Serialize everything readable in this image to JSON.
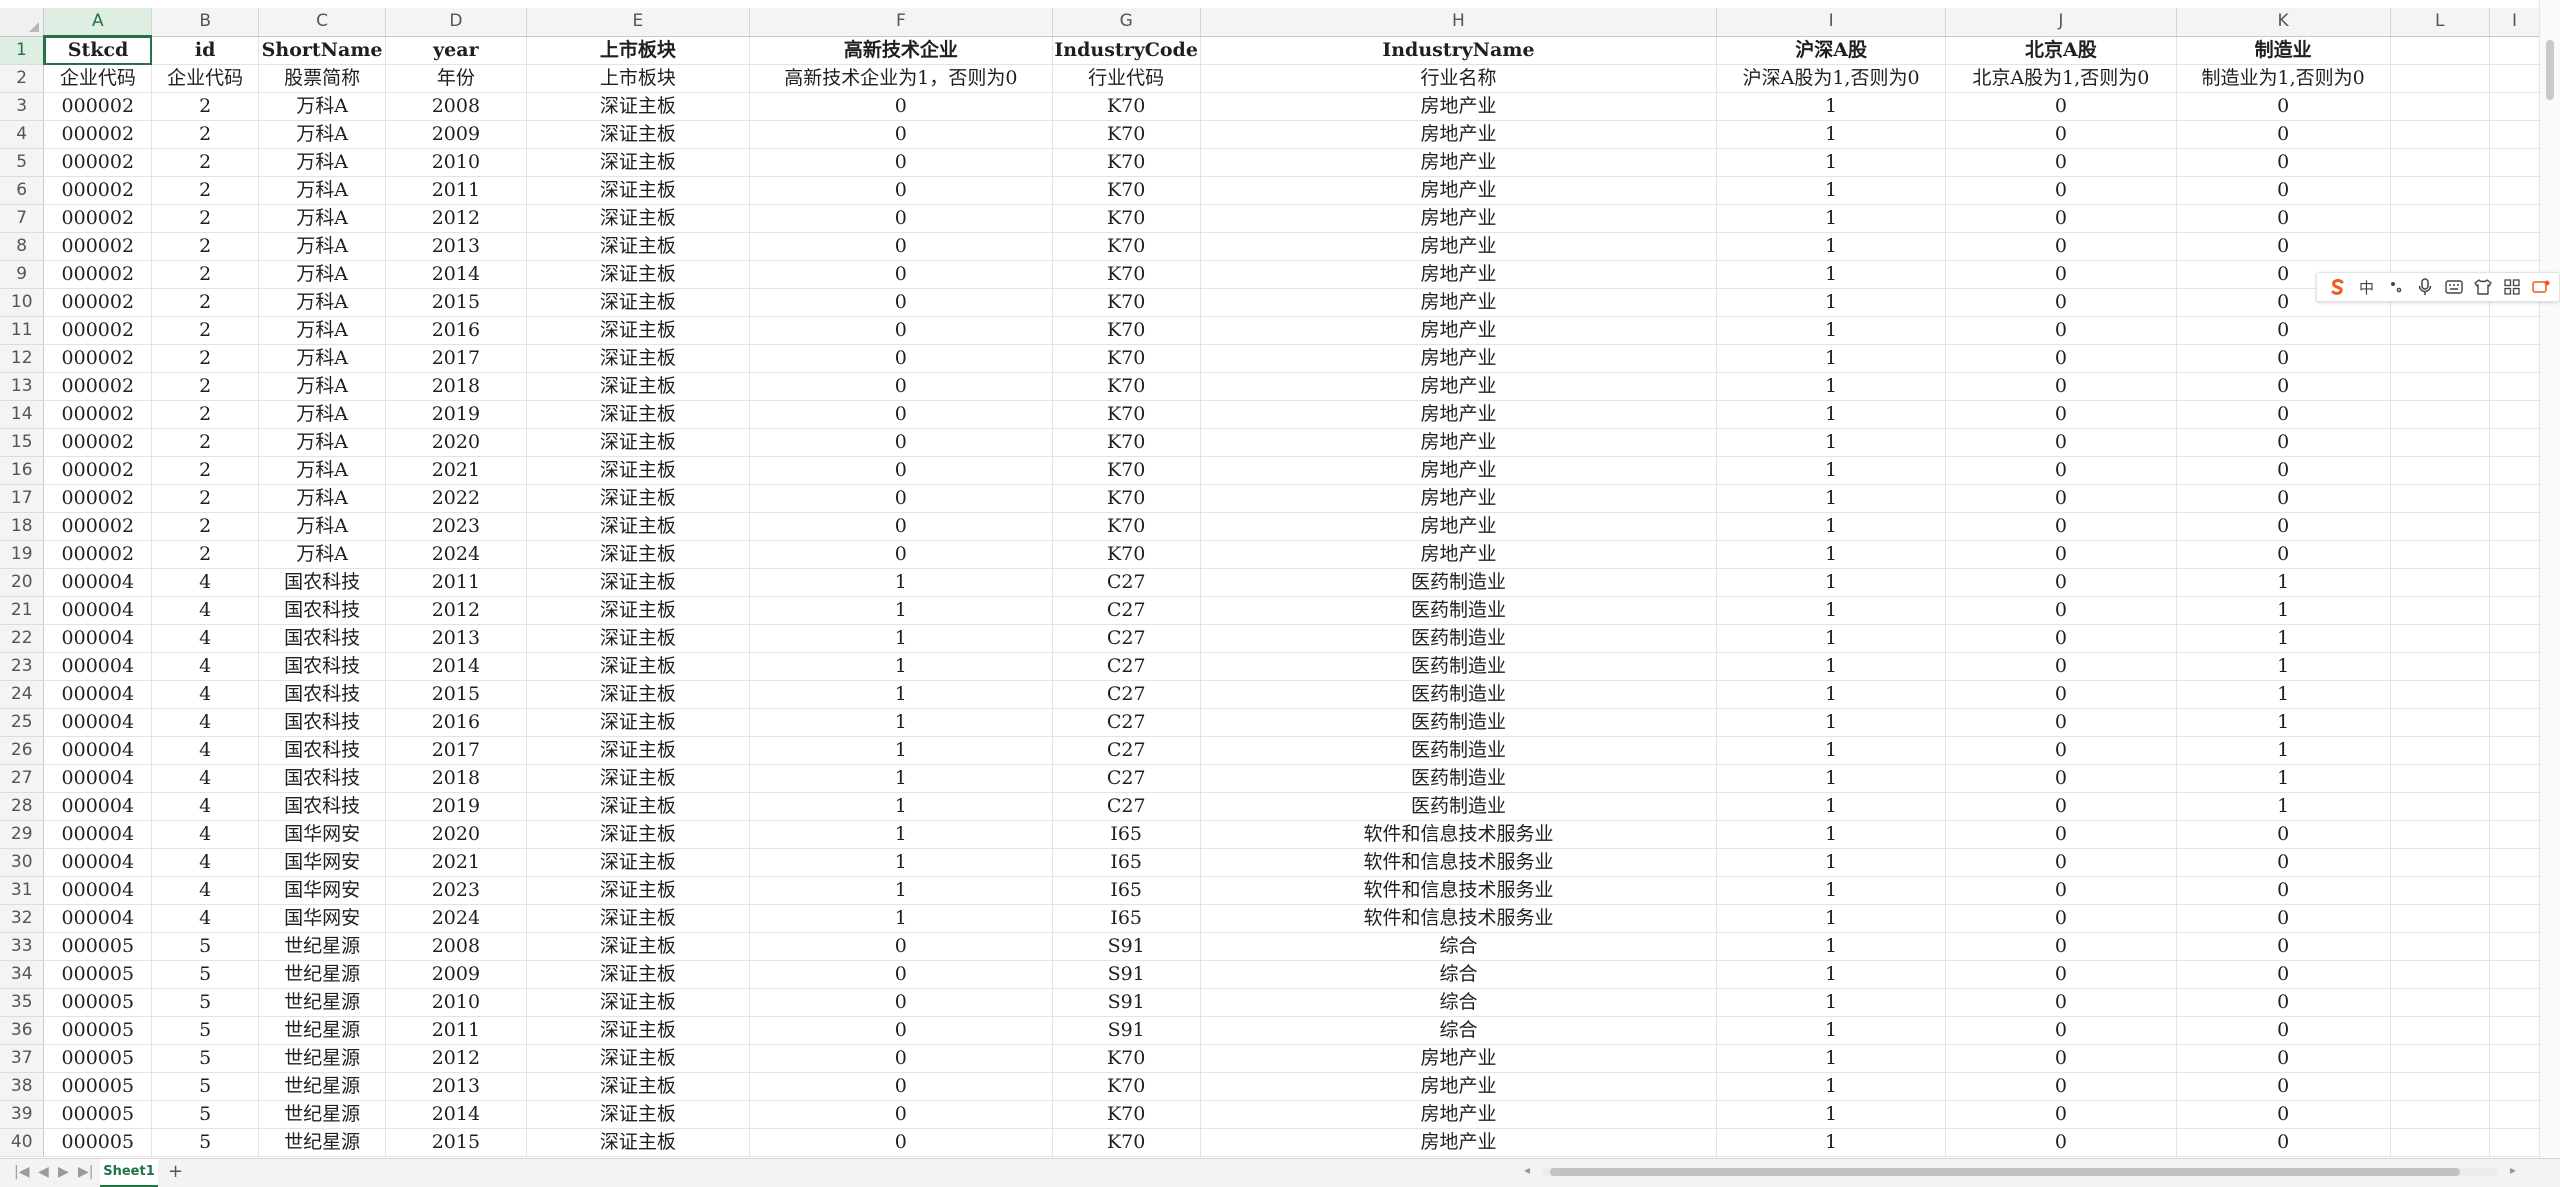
{
  "columns": [
    "A",
    "B",
    "C",
    "D",
    "E",
    "F",
    "G",
    "H",
    "I",
    "J",
    "K",
    "L",
    "I"
  ],
  "header_row1": [
    "Stkcd",
    "id",
    "ShortName",
    "year",
    "上市板块",
    "高新技术企业",
    "IndustryCode",
    "IndustryName",
    "沪深A股",
    "北京A股",
    "制造业",
    "",
    ""
  ],
  "header_row2": [
    "企业代码",
    "企业代码",
    "股票简称",
    "年份",
    "上市板块",
    "高新技术企业为1，否则为0",
    "行业代码",
    "行业名称",
    "沪深A股为1,否则为0",
    "北京A股为1,否则为0",
    "制造业为1,否则为0",
    "",
    ""
  ],
  "rows": [
    [
      "000002",
      "2",
      "万科A",
      "2008",
      "深证主板",
      "0",
      "K70",
      "房地产业",
      "1",
      "0",
      "0"
    ],
    [
      "000002",
      "2",
      "万科A",
      "2009",
      "深证主板",
      "0",
      "K70",
      "房地产业",
      "1",
      "0",
      "0"
    ],
    [
      "000002",
      "2",
      "万科A",
      "2010",
      "深证主板",
      "0",
      "K70",
      "房地产业",
      "1",
      "0",
      "0"
    ],
    [
      "000002",
      "2",
      "万科A",
      "2011",
      "深证主板",
      "0",
      "K70",
      "房地产业",
      "1",
      "0",
      "0"
    ],
    [
      "000002",
      "2",
      "万科A",
      "2012",
      "深证主板",
      "0",
      "K70",
      "房地产业",
      "1",
      "0",
      "0"
    ],
    [
      "000002",
      "2",
      "万科A",
      "2013",
      "深证主板",
      "0",
      "K70",
      "房地产业",
      "1",
      "0",
      "0"
    ],
    [
      "000002",
      "2",
      "万科A",
      "2014",
      "深证主板",
      "0",
      "K70",
      "房地产业",
      "1",
      "0",
      "0"
    ],
    [
      "000002",
      "2",
      "万科A",
      "2015",
      "深证主板",
      "0",
      "K70",
      "房地产业",
      "1",
      "0",
      "0"
    ],
    [
      "000002",
      "2",
      "万科A",
      "2016",
      "深证主板",
      "0",
      "K70",
      "房地产业",
      "1",
      "0",
      "0"
    ],
    [
      "000002",
      "2",
      "万科A",
      "2017",
      "深证主板",
      "0",
      "K70",
      "房地产业",
      "1",
      "0",
      "0"
    ],
    [
      "000002",
      "2",
      "万科A",
      "2018",
      "深证主板",
      "0",
      "K70",
      "房地产业",
      "1",
      "0",
      "0"
    ],
    [
      "000002",
      "2",
      "万科A",
      "2019",
      "深证主板",
      "0",
      "K70",
      "房地产业",
      "1",
      "0",
      "0"
    ],
    [
      "000002",
      "2",
      "万科A",
      "2020",
      "深证主板",
      "0",
      "K70",
      "房地产业",
      "1",
      "0",
      "0"
    ],
    [
      "000002",
      "2",
      "万科A",
      "2021",
      "深证主板",
      "0",
      "K70",
      "房地产业",
      "1",
      "0",
      "0"
    ],
    [
      "000002",
      "2",
      "万科A",
      "2022",
      "深证主板",
      "0",
      "K70",
      "房地产业",
      "1",
      "0",
      "0"
    ],
    [
      "000002",
      "2",
      "万科A",
      "2023",
      "深证主板",
      "0",
      "K70",
      "房地产业",
      "1",
      "0",
      "0"
    ],
    [
      "000002",
      "2",
      "万科A",
      "2024",
      "深证主板",
      "0",
      "K70",
      "房地产业",
      "1",
      "0",
      "0"
    ],
    [
      "000004",
      "4",
      "国农科技",
      "2011",
      "深证主板",
      "1",
      "C27",
      "医药制造业",
      "1",
      "0",
      "1"
    ],
    [
      "000004",
      "4",
      "国农科技",
      "2012",
      "深证主板",
      "1",
      "C27",
      "医药制造业",
      "1",
      "0",
      "1"
    ],
    [
      "000004",
      "4",
      "国农科技",
      "2013",
      "深证主板",
      "1",
      "C27",
      "医药制造业",
      "1",
      "0",
      "1"
    ],
    [
      "000004",
      "4",
      "国农科技",
      "2014",
      "深证主板",
      "1",
      "C27",
      "医药制造业",
      "1",
      "0",
      "1"
    ],
    [
      "000004",
      "4",
      "国农科技",
      "2015",
      "深证主板",
      "1",
      "C27",
      "医药制造业",
      "1",
      "0",
      "1"
    ],
    [
      "000004",
      "4",
      "国农科技",
      "2016",
      "深证主板",
      "1",
      "C27",
      "医药制造业",
      "1",
      "0",
      "1"
    ],
    [
      "000004",
      "4",
      "国农科技",
      "2017",
      "深证主板",
      "1",
      "C27",
      "医药制造业",
      "1",
      "0",
      "1"
    ],
    [
      "000004",
      "4",
      "国农科技",
      "2018",
      "深证主板",
      "1",
      "C27",
      "医药制造业",
      "1",
      "0",
      "1"
    ],
    [
      "000004",
      "4",
      "国农科技",
      "2019",
      "深证主板",
      "1",
      "C27",
      "医药制造业",
      "1",
      "0",
      "1"
    ],
    [
      "000004",
      "4",
      "国华网安",
      "2020",
      "深证主板",
      "1",
      "I65",
      "软件和信息技术服务业",
      "1",
      "0",
      "0"
    ],
    [
      "000004",
      "4",
      "国华网安",
      "2021",
      "深证主板",
      "1",
      "I65",
      "软件和信息技术服务业",
      "1",
      "0",
      "0"
    ],
    [
      "000004",
      "4",
      "国华网安",
      "2023",
      "深证主板",
      "1",
      "I65",
      "软件和信息技术服务业",
      "1",
      "0",
      "0"
    ],
    [
      "000004",
      "4",
      "国华网安",
      "2024",
      "深证主板",
      "1",
      "I65",
      "软件和信息技术服务业",
      "1",
      "0",
      "0"
    ],
    [
      "000005",
      "5",
      "世纪星源",
      "2008",
      "深证主板",
      "0",
      "S91",
      "综合",
      "1",
      "0",
      "0"
    ],
    [
      "000005",
      "5",
      "世纪星源",
      "2009",
      "深证主板",
      "0",
      "S91",
      "综合",
      "1",
      "0",
      "0"
    ],
    [
      "000005",
      "5",
      "世纪星源",
      "2010",
      "深证主板",
      "0",
      "S91",
      "综合",
      "1",
      "0",
      "0"
    ],
    [
      "000005",
      "5",
      "世纪星源",
      "2011",
      "深证主板",
      "0",
      "S91",
      "综合",
      "1",
      "0",
      "0"
    ],
    [
      "000005",
      "5",
      "世纪星源",
      "2012",
      "深证主板",
      "0",
      "K70",
      "房地产业",
      "1",
      "0",
      "0"
    ],
    [
      "000005",
      "5",
      "世纪星源",
      "2013",
      "深证主板",
      "0",
      "K70",
      "房地产业",
      "1",
      "0",
      "0"
    ],
    [
      "000005",
      "5",
      "世纪星源",
      "2014",
      "深证主板",
      "0",
      "K70",
      "房地产业",
      "1",
      "0",
      "0"
    ],
    [
      "000005",
      "5",
      "世纪星源",
      "2015",
      "深证主板",
      "0",
      "K70",
      "房地产业",
      "1",
      "0",
      "0"
    ]
  ],
  "first_row_number": 1,
  "active_cell": "A1",
  "sheet_tabs": [
    "Sheet1"
  ],
  "ime_toolbar": {
    "lang_label": "中",
    "icons": [
      "sogou-logo-icon",
      "chinese-mode-icon",
      "punctuation-icon",
      "microphone-icon",
      "keyboard-icon",
      "skin-icon",
      "grid-menu-icon",
      "extra-icon"
    ]
  },
  "colors": {
    "accent": "#217346",
    "red_header": "#e00000"
  },
  "nav": {
    "first": "|◀",
    "prev": "◀",
    "next": "▶",
    "last": "▶|",
    "add": "+"
  }
}
